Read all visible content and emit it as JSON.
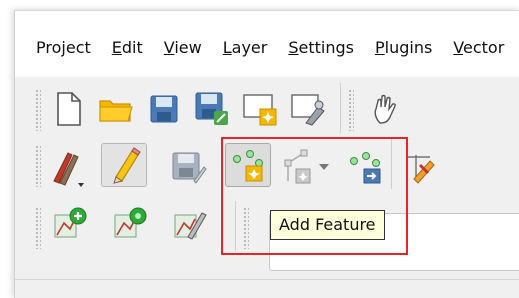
{
  "menubar": {
    "items": [
      {
        "pre": "Pro",
        "u": "j",
        "post": "ect"
      },
      {
        "pre": "",
        "u": "E",
        "post": "dit"
      },
      {
        "pre": "",
        "u": "V",
        "post": "iew"
      },
      {
        "pre": "",
        "u": "L",
        "post": "ayer"
      },
      {
        "pre": "",
        "u": "S",
        "post": "ettings"
      },
      {
        "pre": "",
        "u": "P",
        "post": "lugins"
      },
      {
        "pre": "",
        "u": "V",
        "post": "ector"
      }
    ]
  },
  "tooltip": {
    "text": "Add Feature"
  },
  "icons": {
    "row1": [
      "new-project-icon",
      "open-project-icon",
      "save-project-icon",
      "save-as-icon",
      "new-print-layout-icon",
      "layout-manager-icon",
      "pan-icon"
    ],
    "row2": [
      "digitizing-pencils-icon",
      "toggle-editing-icon",
      "save-layer-edits-icon",
      "add-feature-icon",
      "vertex-tool-icon",
      "merge-features-icon",
      "attribute-edit-icon"
    ],
    "row3": [
      "add-layer-icon",
      "new-layer-icon",
      "edit-geometry-icon"
    ]
  },
  "colors": {
    "highlight": "#e8242b",
    "tooltip_bg": "#ffffdc"
  }
}
